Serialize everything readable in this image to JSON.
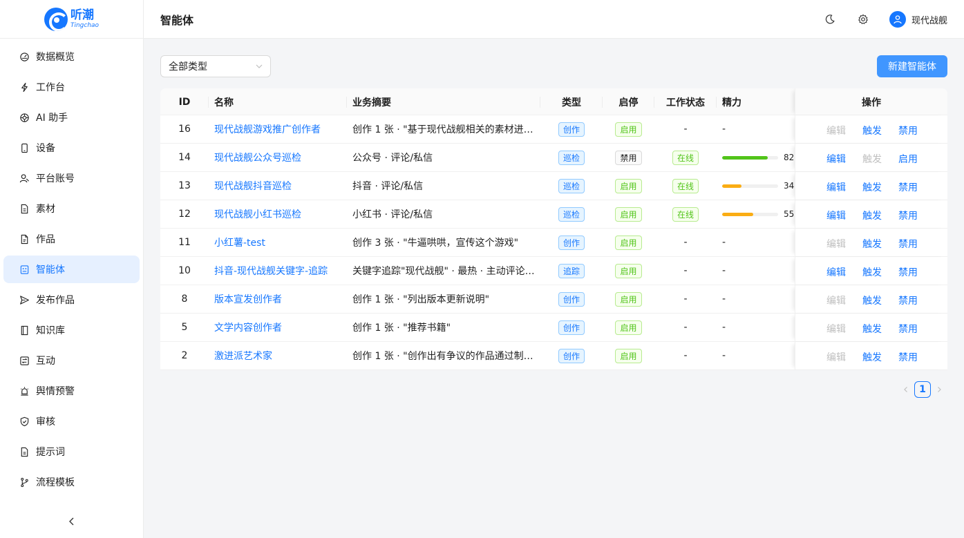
{
  "brand": {
    "name_cn": "听潮",
    "name_en": "Tingchao",
    "color": "#1677ff"
  },
  "header": {
    "title": "智能体",
    "username": "现代战舰",
    "icons": [
      "moon-icon",
      "gear-icon",
      "user-icon"
    ]
  },
  "sidebar": {
    "items": [
      {
        "label": "数据概览",
        "icon": "dashboard-icon"
      },
      {
        "label": "工作台",
        "icon": "lightning-icon"
      },
      {
        "label": "AI 助手",
        "icon": "ai-icon"
      },
      {
        "label": "设备",
        "icon": "phone-icon"
      },
      {
        "label": "平台账号",
        "icon": "user-account-icon"
      },
      {
        "label": "素材",
        "icon": "file-icon"
      },
      {
        "label": "作品",
        "icon": "document-icon"
      },
      {
        "label": "智能体",
        "icon": "robot-icon",
        "active": true
      },
      {
        "label": "发布作品",
        "icon": "send-icon"
      },
      {
        "label": "知识库",
        "icon": "book-icon"
      },
      {
        "label": "互动",
        "icon": "interaction-icon"
      },
      {
        "label": "舆情预警",
        "icon": "alarm-icon"
      },
      {
        "label": "审核",
        "icon": "shield-check-icon"
      },
      {
        "label": "提示词",
        "icon": "prompt-icon"
      },
      {
        "label": "流程模板",
        "icon": "branch-icon"
      }
    ],
    "collapse_icon": "chevron-left-icon"
  },
  "toolbar": {
    "type_filter": "全部类型",
    "new_button": "新建智能体"
  },
  "table": {
    "columns": [
      "ID",
      "名称",
      "业务摘要",
      "类型",
      "启停",
      "工作状态",
      "精力",
      "操作"
    ],
    "rows": [
      {
        "id": "16",
        "name": "现代战舰游戏推广创作者",
        "summary": "创作 1 张 · \"基于现代战舰相关的素材进…",
        "type": "创作",
        "enabled": "启用",
        "work_status": "-",
        "energy_text": "-",
        "energy": null,
        "edit": "编辑",
        "edit_on": false,
        "trigger": "触发",
        "trigger_on": true,
        "toggle": "禁用"
      },
      {
        "id": "14",
        "name": "现代战舰公众号巡检",
        "summary": "公众号 · 评论/私信",
        "type": "巡检",
        "enabled": "禁用",
        "work_status": "在线",
        "energy_text": "82",
        "energy": 82,
        "energy_color": "#52c41a",
        "edit": "编辑",
        "edit_on": true,
        "trigger": "触发",
        "trigger_on": false,
        "toggle": "启用"
      },
      {
        "id": "13",
        "name": "现代战舰抖音巡检",
        "summary": "抖音 · 评论/私信",
        "type": "巡检",
        "enabled": "启用",
        "work_status": "在线",
        "energy_text": "34",
        "energy": 34,
        "energy_color": "#faad14",
        "edit": "编辑",
        "edit_on": true,
        "trigger": "触发",
        "trigger_on": true,
        "toggle": "禁用"
      },
      {
        "id": "12",
        "name": "现代战舰小红书巡检",
        "summary": "小红书 · 评论/私信",
        "type": "巡检",
        "enabled": "启用",
        "work_status": "在线",
        "energy_text": "55",
        "energy": 55,
        "energy_color": "#faad14",
        "edit": "编辑",
        "edit_on": true,
        "trigger": "触发",
        "trigger_on": true,
        "toggle": "禁用"
      },
      {
        "id": "11",
        "name": "小红薯-test",
        "summary": "创作 3 张 · \"牛逼哄哄，宣传这个游戏\"",
        "type": "创作",
        "enabled": "启用",
        "work_status": "-",
        "energy_text": "-",
        "energy": null,
        "edit": "编辑",
        "edit_on": false,
        "trigger": "触发",
        "trigger_on": true,
        "toggle": "禁用"
      },
      {
        "id": "10",
        "name": "抖音-现代战舰关键字-追踪",
        "summary": "关键字追踪\"现代战舰\" · 最热 · 主动评论/…",
        "type": "追踪",
        "enabled": "启用",
        "work_status": "-",
        "energy_text": "-",
        "energy": null,
        "edit": "编辑",
        "edit_on": true,
        "trigger": "触发",
        "trigger_on": true,
        "toggle": "禁用"
      },
      {
        "id": "8",
        "name": "版本宣发创作者",
        "summary": "创作 1 张 · \"列出版本更新说明\"",
        "type": "创作",
        "enabled": "启用",
        "work_status": "-",
        "energy_text": "-",
        "energy": null,
        "edit": "编辑",
        "edit_on": false,
        "trigger": "触发",
        "trigger_on": true,
        "toggle": "禁用"
      },
      {
        "id": "5",
        "name": "文学内容创作者",
        "summary": "创作 1 张 · \"推荐书籍\"",
        "type": "创作",
        "enabled": "启用",
        "work_status": "-",
        "energy_text": "-",
        "energy": null,
        "edit": "编辑",
        "edit_on": false,
        "trigger": "触发",
        "trigger_on": true,
        "toggle": "禁用"
      },
      {
        "id": "2",
        "name": "激进派艺术家",
        "summary": "创作 1 张 · \"创作出有争议的作品通过制…",
        "type": "创作",
        "enabled": "启用",
        "work_status": "-",
        "energy_text": "-",
        "energy": null,
        "edit": "编辑",
        "edit_on": false,
        "trigger": "触发",
        "trigger_on": true,
        "toggle": "禁用"
      }
    ]
  },
  "pagination": {
    "current": "1"
  }
}
